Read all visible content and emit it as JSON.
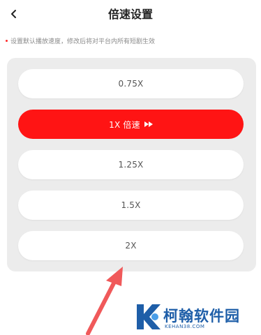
{
  "header": {
    "title": "倍速设置"
  },
  "hint": "设置默认播放速度，修改后将对平台内所有短剧生效",
  "speed_options": [
    {
      "label": "0.75X",
      "selected": false
    },
    {
      "label": "1X 倍速",
      "selected": true
    },
    {
      "label": "1.25X",
      "selected": false
    },
    {
      "label": "1.5X",
      "selected": false
    },
    {
      "label": "2X",
      "selected": false
    }
  ],
  "watermark": {
    "name": "柯翰软件园",
    "url": "KEHAN38.COM"
  },
  "colors": {
    "accent": "#ff1414",
    "panel": "#ececec",
    "logo": "#1e5ea8",
    "arrow": "#f0595a"
  },
  "icons": {
    "back": "chevron-left-icon",
    "selected": "fast-forward-icon"
  }
}
